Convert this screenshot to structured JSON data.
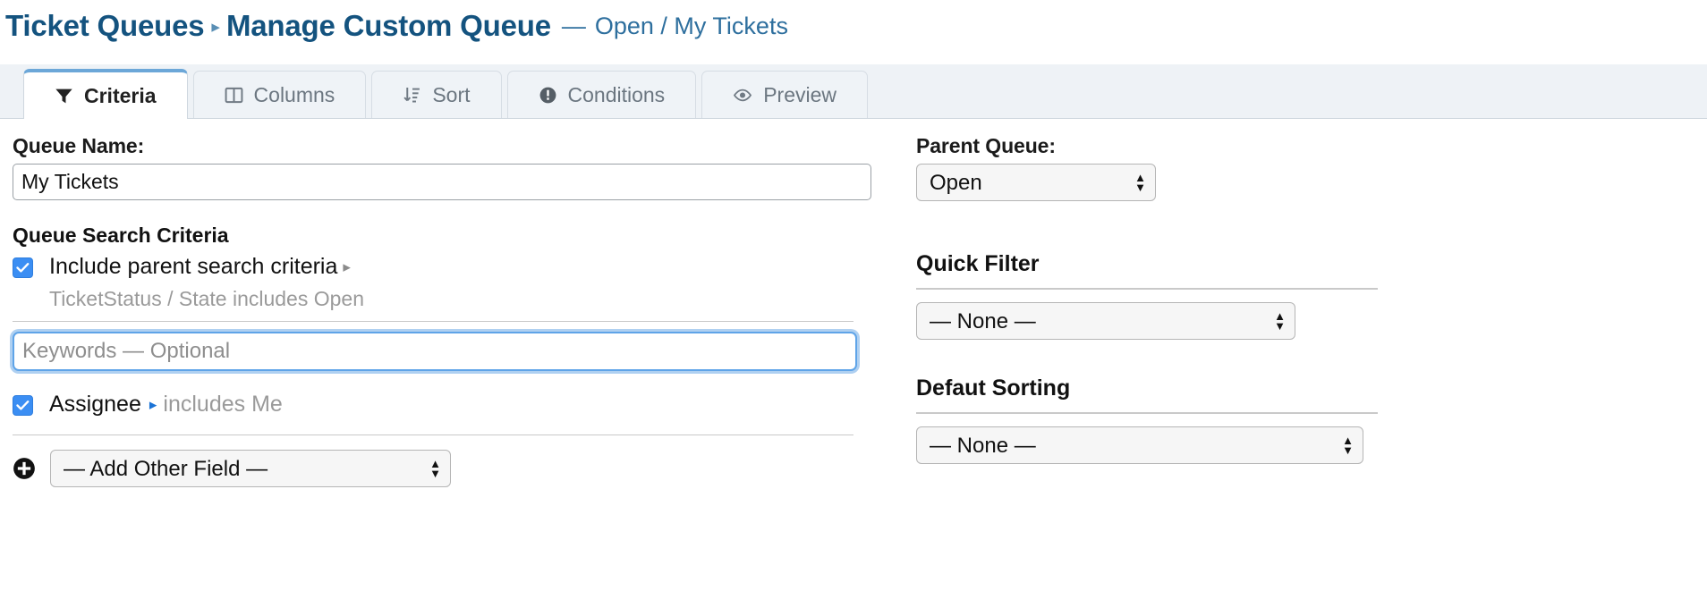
{
  "header": {
    "root_label": "Ticket Queues",
    "separator": "▸",
    "current_label": "Manage Custom Queue",
    "dash": "—",
    "subtitle": "Open / My Tickets"
  },
  "tabs": [
    {
      "label": "Criteria",
      "icon": "filter-icon",
      "active": true
    },
    {
      "label": "Columns",
      "icon": "columns-icon",
      "active": false
    },
    {
      "label": "Sort",
      "icon": "sort-icon",
      "active": false
    },
    {
      "label": "Conditions",
      "icon": "exclamation-circle-icon",
      "active": false
    },
    {
      "label": "Preview",
      "icon": "eye-icon",
      "active": false
    }
  ],
  "left": {
    "queue_name_label": "Queue Name:",
    "queue_name_value": "My Tickets",
    "search_criteria_title": "Queue Search Criteria",
    "include_parent": {
      "label": "Include parent search criteria",
      "caret": "▸",
      "checked": true,
      "detail": "TicketStatus / State includes Open"
    },
    "keywords_placeholder": "Keywords — Optional",
    "keywords_value": "",
    "assignee": {
      "label": "Assignee",
      "caret": "▸",
      "condition": "includes Me",
      "checked": true
    },
    "add_other_field": {
      "icon": "plus-circle-icon",
      "selected": "— Add Other Field —"
    }
  },
  "right": {
    "parent_queue_label": "Parent Queue:",
    "parent_queue_value": "Open",
    "quick_filter_title": "Quick Filter",
    "quick_filter_value": "— None —",
    "default_sorting_title": "Defaut Sorting",
    "default_sorting_value": "— None —"
  },
  "colors": {
    "breadcrumb_blue": "#14537f",
    "subtitle_blue": "#2e6f9e",
    "checkbox_blue": "#3b8ef3",
    "focus_ring_blue": "#5fa4e8",
    "active_tab_top": "#6ca7d8",
    "muted_text": "#9a9a9a"
  }
}
